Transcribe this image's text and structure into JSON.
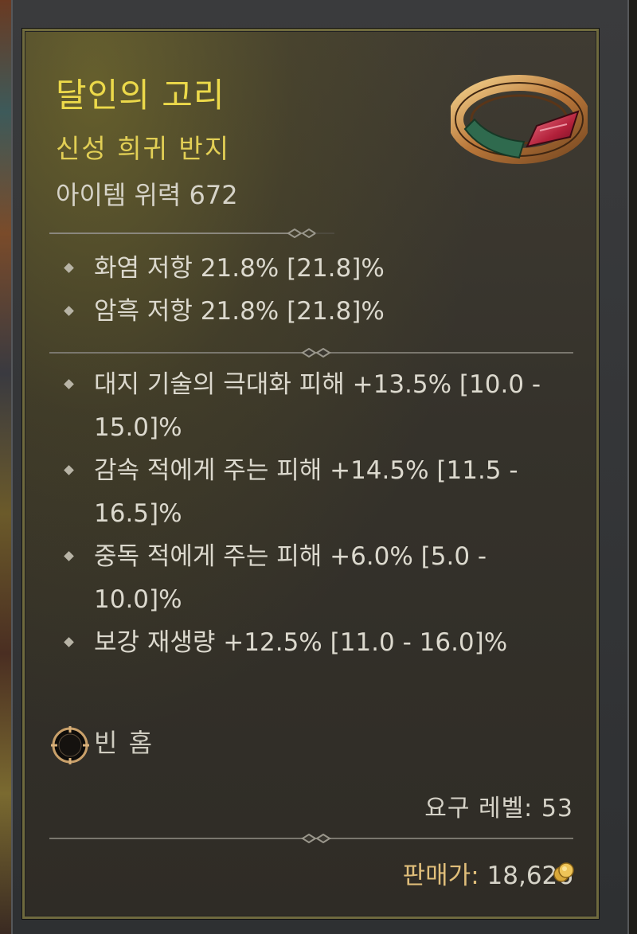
{
  "item": {
    "name": "달인의 고리",
    "type": "신성 희귀 반지",
    "power": "아이템 위력 672",
    "icon": "ring-icon"
  },
  "resistances": [
    "화염 저항 21.8% [21.8]%",
    "암흑 저항 21.8% [21.8]%"
  ],
  "affixes": [
    "대지 기술의 극대화 피해 +13.5% [10.0 - 15.0]%",
    "감속 적에게 주는 피해 +14.5% [11.5 - 16.5]%",
    "중독 적에게 주는 피해 +6.0% [5.0 - 10.0]%",
    "보강 재생량 +12.5% [11.0 - 16.0]%"
  ],
  "socket": {
    "label": "빈 홈",
    "icon": "empty-socket-icon"
  },
  "requirement": "요구 레벨: 53",
  "sell": {
    "label": "판매가:",
    "value": "18,626",
    "icon": "gold-coin-icon"
  },
  "colors": {
    "title": "#ecd94a",
    "subtitle": "#e2cf55",
    "text": "#dcd9ce",
    "sell_label": "#e0be7a",
    "panel_border": "#6f6a3e"
  }
}
